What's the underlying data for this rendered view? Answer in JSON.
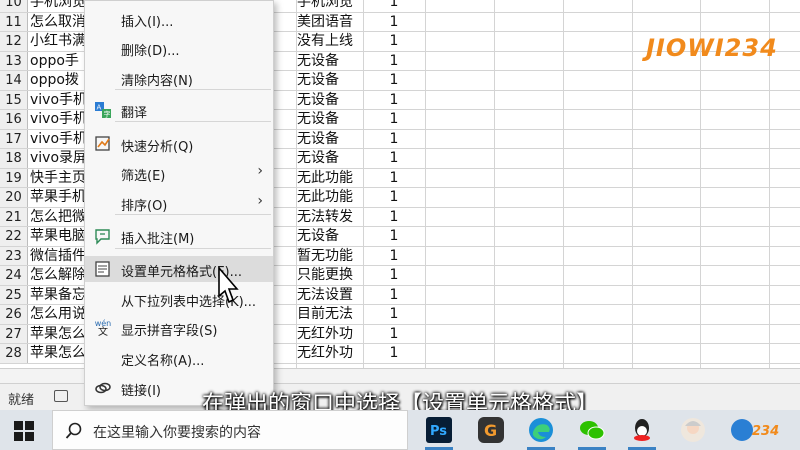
{
  "sheet": {
    "rows": [
      {
        "num": "10",
        "a": "手机浏览",
        "d": "手机浏览",
        "e": "1"
      },
      {
        "num": "11",
        "a": "怎么取消",
        "d": "美团语音",
        "e": "1"
      },
      {
        "num": "12",
        "a": "小红书满",
        "d": "没有上线",
        "e": "1"
      },
      {
        "num": "13",
        "a": "oppo手",
        "d": "无设备",
        "e": "1"
      },
      {
        "num": "14",
        "a": "oppo拨",
        "d": "无设备",
        "e": "1"
      },
      {
        "num": "15",
        "a": "vivo手机",
        "d": "无设备",
        "e": "1"
      },
      {
        "num": "16",
        "a": "vivo手机",
        "d": "无设备",
        "e": "1"
      },
      {
        "num": "17",
        "a": "vivo手机",
        "d": "无设备",
        "e": "1"
      },
      {
        "num": "18",
        "a": "vivo录屏",
        "d": "无设备",
        "e": "1"
      },
      {
        "num": "19",
        "a": "快手主页",
        "d": "无此功能",
        "e": "1"
      },
      {
        "num": "20",
        "a": "苹果手机",
        "d": "无此功能",
        "e": "1"
      },
      {
        "num": "21",
        "a": "怎么把微",
        "d": "无法转发",
        "e": "1"
      },
      {
        "num": "22",
        "a": "苹果电脑",
        "d": "无设备",
        "e": "1"
      },
      {
        "num": "23",
        "a": "微信插件",
        "d": "暂无功能",
        "e": "1"
      },
      {
        "num": "24",
        "a": "怎么解除",
        "d": "只能更换",
        "e": "1"
      },
      {
        "num": "25",
        "a": "苹果备忘",
        "d": "无法设置",
        "e": "1"
      },
      {
        "num": "26",
        "a": "怎么用说",
        "d": "目前无法",
        "e": "1"
      },
      {
        "num": "27",
        "a": "苹果怎么",
        "d": "无红外功",
        "e": "1"
      },
      {
        "num": "28",
        "a": "苹果怎么",
        "d": "无红外功",
        "e": "1"
      }
    ]
  },
  "menu": {
    "items": [
      {
        "label": "插入(I)...",
        "icon": "none"
      },
      {
        "label": "删除(D)...",
        "icon": "none"
      },
      {
        "label": "清除内容(N)",
        "icon": "none"
      },
      {
        "label": "翻译",
        "icon": "translate-icon"
      },
      {
        "label": "快速分析(Q)",
        "icon": "quick-analysis-icon"
      },
      {
        "label": "筛选(E)",
        "icon": "none",
        "submenu": true
      },
      {
        "label": "排序(O)",
        "icon": "none",
        "submenu": true
      },
      {
        "label": "插入批注(M)",
        "icon": "comment-icon"
      },
      {
        "label": "设置单元格格式(F)...",
        "icon": "format-cells-icon"
      },
      {
        "label": "从下拉列表中选择(K)...",
        "icon": "none"
      },
      {
        "label": "显示拼音字段(S)",
        "icon": "phonetic-icon"
      },
      {
        "label": "定义名称(A)...",
        "icon": "none"
      },
      {
        "label": "链接(I)",
        "icon": "link-icon"
      }
    ],
    "arrow_glyph": "›",
    "phonetic_top": "wén",
    "phonetic_bottom": "文"
  },
  "status": {
    "ready": "就绪"
  },
  "watermark": "JIOWI234",
  "subtitle": "在弹出的窗口中选择【设置单元格格式】",
  "taskbar": {
    "search_placeholder": "在这里输入你要搜索的内容",
    "apps": [
      "photoshop-icon",
      "g-app-icon",
      "edge-icon",
      "wechat-icon",
      "qq-icon",
      "avatar-app-icon",
      "watermark-app-icon"
    ]
  },
  "colors": {
    "accent": "#f18a1c",
    "highlight": "#dcdcdc"
  }
}
